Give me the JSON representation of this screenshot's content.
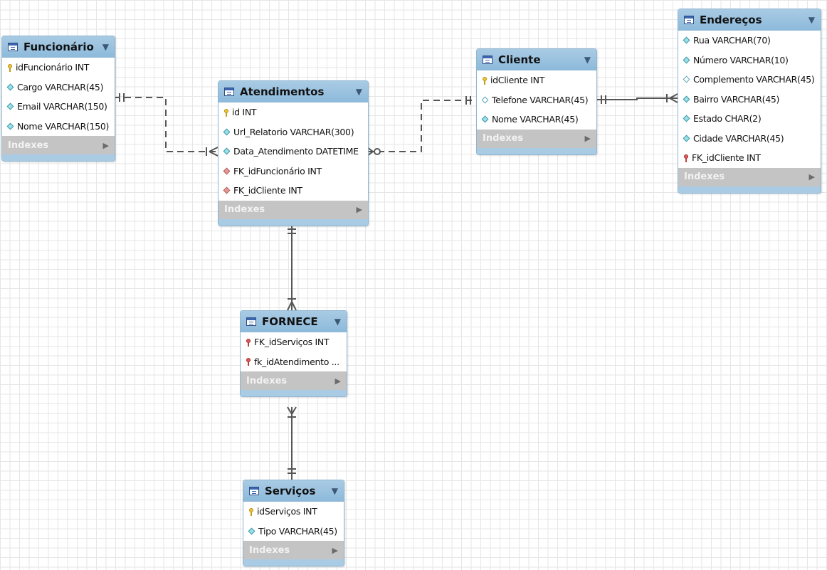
{
  "tables": {
    "funcionario": {
      "name": "Funcionário",
      "columns": [
        {
          "kind": "pk",
          "label": "idFuncionário INT"
        },
        {
          "kind": "col",
          "label": "Cargo VARCHAR(45)"
        },
        {
          "kind": "col",
          "label": "Email VARCHAR(150)"
        },
        {
          "kind": "col",
          "label": "Nome VARCHAR(150)"
        }
      ],
      "indexes_label": "Indexes"
    },
    "atendimentos": {
      "name": "Atendimentos",
      "columns": [
        {
          "kind": "pk",
          "label": "id INT"
        },
        {
          "kind": "col",
          "label": "Url_Relatorio VARCHAR(300)"
        },
        {
          "kind": "col",
          "label": "Data_Atendimento DATETIME"
        },
        {
          "kind": "fk-diamond",
          "label": "FK_idFuncionário INT"
        },
        {
          "kind": "fk-diamond",
          "label": "FK_idCliente INT"
        }
      ],
      "indexes_label": "Indexes"
    },
    "cliente": {
      "name": "Cliente",
      "columns": [
        {
          "kind": "pk",
          "label": "idCliente INT"
        },
        {
          "kind": "col-empty",
          "label": "Telefone VARCHAR(45)"
        },
        {
          "kind": "col",
          "label": "Nome VARCHAR(45)"
        }
      ],
      "indexes_label": "Indexes"
    },
    "enderecos": {
      "name": "Endereços",
      "columns": [
        {
          "kind": "col",
          "label": "Rua VARCHAR(70)"
        },
        {
          "kind": "col",
          "label": "Número VARCHAR(10)"
        },
        {
          "kind": "col-empty",
          "label": "Complemento VARCHAR(45)"
        },
        {
          "kind": "col",
          "label": "Bairro VARCHAR(45)"
        },
        {
          "kind": "col",
          "label": "Estado CHAR(2)"
        },
        {
          "kind": "col",
          "label": "Cidade VARCHAR(45)"
        },
        {
          "kind": "fk",
          "label": "FK_idCliente INT"
        }
      ],
      "indexes_label": "Indexes"
    },
    "fornece": {
      "name": "FORNECE",
      "columns": [
        {
          "kind": "fk",
          "label": "FK_idServiços INT"
        },
        {
          "kind": "fk",
          "label": "fk_idAtendimento ..."
        }
      ],
      "indexes_label": "Indexes"
    },
    "servicos": {
      "name": "Serviços",
      "columns": [
        {
          "kind": "pk",
          "label": "idServiços INT"
        },
        {
          "kind": "col",
          "label": "Tipo VARCHAR(45)"
        }
      ],
      "indexes_label": "Indexes"
    }
  },
  "colors": {
    "header": "#a9cbe4",
    "connector": "#555555",
    "indexes_bar": "#c4c4c4",
    "grid": "#e6e6e6"
  },
  "icons": {
    "table": "table-icon",
    "collapse": "collapse-arrow-icon",
    "primary_key": "key-icon",
    "foreign_key": "red-key-icon",
    "column": "diamond-icon",
    "indexes_expand": "expand-triangle-icon"
  }
}
